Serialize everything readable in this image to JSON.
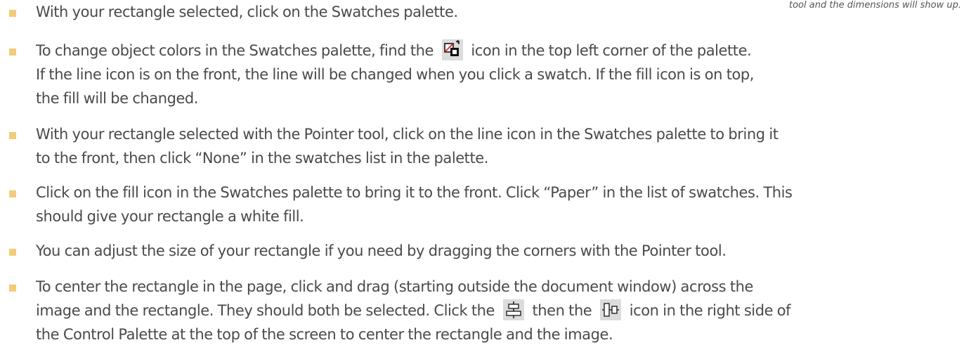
{
  "side_note": "tool and the dimensions will show up.",
  "steps": [
    {
      "lines": [
        "With your rectangle selected, click on the Swatches palette."
      ]
    },
    {
      "line1_before_icon": "To change object colors in the Swatches palette, find the",
      "line1_after_icon": "icon in the top left corner of the palette.",
      "icon": "fill-stroke-swatch-icon",
      "lines_rest": [
        "If the line icon is on the front, the line will be changed when you click a swatch. If the fill icon is on top,",
        "the fill will be changed."
      ]
    },
    {
      "lines": [
        "With your rectangle selected with the Pointer tool, click on the line icon in the Swatches palette to bring it",
        "to the front, then click “None” in the swatches list in the palette."
      ]
    },
    {
      "lines": [
        "Click on the fill icon in the Swatches palette to bring it to the front. Click “Paper” in the list of swatches. This",
        "should give your rectangle a white fill."
      ]
    },
    {
      "lines": [
        "You can adjust the size of your rectangle if you need by dragging the corners with the Pointer tool."
      ]
    },
    {
      "lines": [
        "To center the rectangle in the page, click and drag (starting outside the document window) across the"
      ],
      "line2_before_icon1": "image and the rectangle. They should both be selected. Click the",
      "line2_between_icons": "then the",
      "line2_after_icon2": "icon in the right side of",
      "icon1": "align-horizontal-centers-icon",
      "icon2": "align-vertical-centers-icon",
      "lines_rest": [
        "the Control Palette at the top of the screen to center the rectangle and the image."
      ]
    }
  ],
  "colors": {
    "bullet": "#f2cc7c",
    "text": "#4a4a4a",
    "icon_bg": "#dcdcdc"
  }
}
